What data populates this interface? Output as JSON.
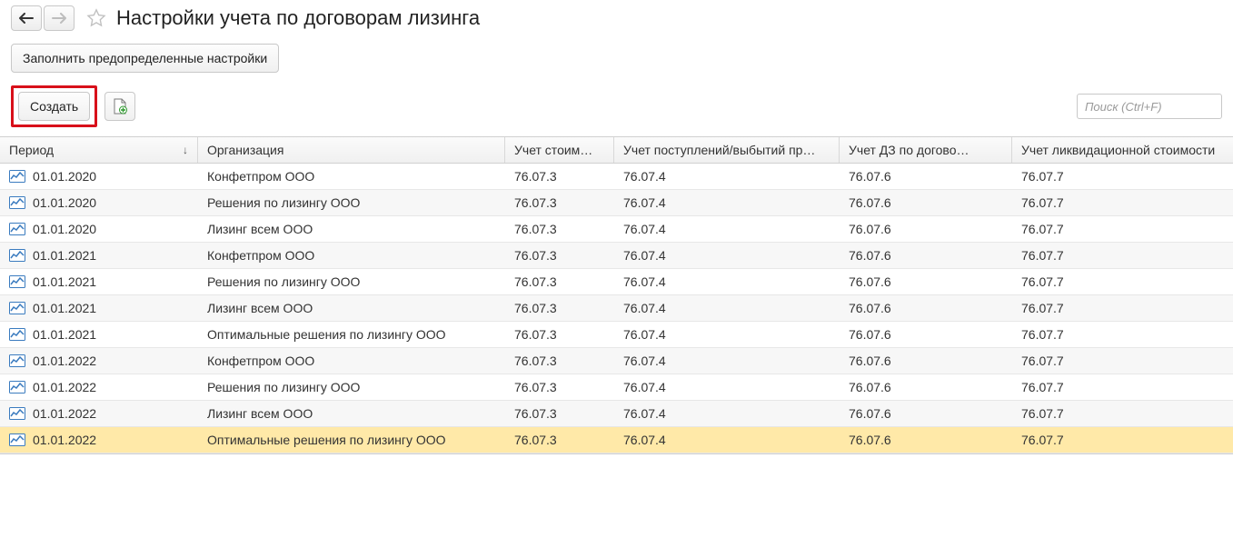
{
  "header": {
    "title": "Настройки учета по договорам лизинга"
  },
  "toolbar": {
    "fill_defaults_label": "Заполнить предопределенные настройки",
    "create_label": "Создать"
  },
  "search": {
    "placeholder": "Поиск (Ctrl+F)"
  },
  "table": {
    "columns": {
      "period": "Период",
      "org": "Организация",
      "c1": "Учет стоим…",
      "c2": "Учет поступлений/выбытий пр…",
      "c3": "Учет ДЗ по догово…",
      "c4": "Учет ликвидационной стоимости"
    },
    "rows": [
      {
        "period": "01.01.2020",
        "org": "Конфетпром ООО",
        "c1": "76.07.3",
        "c2": "76.07.4",
        "c3": "76.07.6",
        "c4": "76.07.7",
        "selected": false
      },
      {
        "period": "01.01.2020",
        "org": "Решения по лизингу ООО",
        "c1": "76.07.3",
        "c2": "76.07.4",
        "c3": "76.07.6",
        "c4": "76.07.7",
        "selected": false
      },
      {
        "period": "01.01.2020",
        "org": "Лизинг всем ООО",
        "c1": "76.07.3",
        "c2": "76.07.4",
        "c3": "76.07.6",
        "c4": "76.07.7",
        "selected": false
      },
      {
        "period": "01.01.2021",
        "org": "Конфетпром ООО",
        "c1": "76.07.3",
        "c2": "76.07.4",
        "c3": "76.07.6",
        "c4": "76.07.7",
        "selected": false
      },
      {
        "period": "01.01.2021",
        "org": "Решения по лизингу ООО",
        "c1": "76.07.3",
        "c2": "76.07.4",
        "c3": "76.07.6",
        "c4": "76.07.7",
        "selected": false
      },
      {
        "period": "01.01.2021",
        "org": "Лизинг всем ООО",
        "c1": "76.07.3",
        "c2": "76.07.4",
        "c3": "76.07.6",
        "c4": "76.07.7",
        "selected": false
      },
      {
        "period": "01.01.2021",
        "org": "Оптимальные решения по лизингу ООО",
        "c1": "76.07.3",
        "c2": "76.07.4",
        "c3": "76.07.6",
        "c4": "76.07.7",
        "selected": false
      },
      {
        "period": "01.01.2022",
        "org": "Конфетпром ООО",
        "c1": "76.07.3",
        "c2": "76.07.4",
        "c3": "76.07.6",
        "c4": "76.07.7",
        "selected": false
      },
      {
        "period": "01.01.2022",
        "org": "Решения по лизингу ООО",
        "c1": "76.07.3",
        "c2": "76.07.4",
        "c3": "76.07.6",
        "c4": "76.07.7",
        "selected": false
      },
      {
        "period": "01.01.2022",
        "org": "Лизинг всем ООО",
        "c1": "76.07.3",
        "c2": "76.07.4",
        "c3": "76.07.6",
        "c4": "76.07.7",
        "selected": false
      },
      {
        "period": "01.01.2022",
        "org": "Оптимальные решения по лизингу ООО",
        "c1": "76.07.3",
        "c2": "76.07.4",
        "c3": "76.07.6",
        "c4": "76.07.7",
        "selected": true
      }
    ]
  }
}
